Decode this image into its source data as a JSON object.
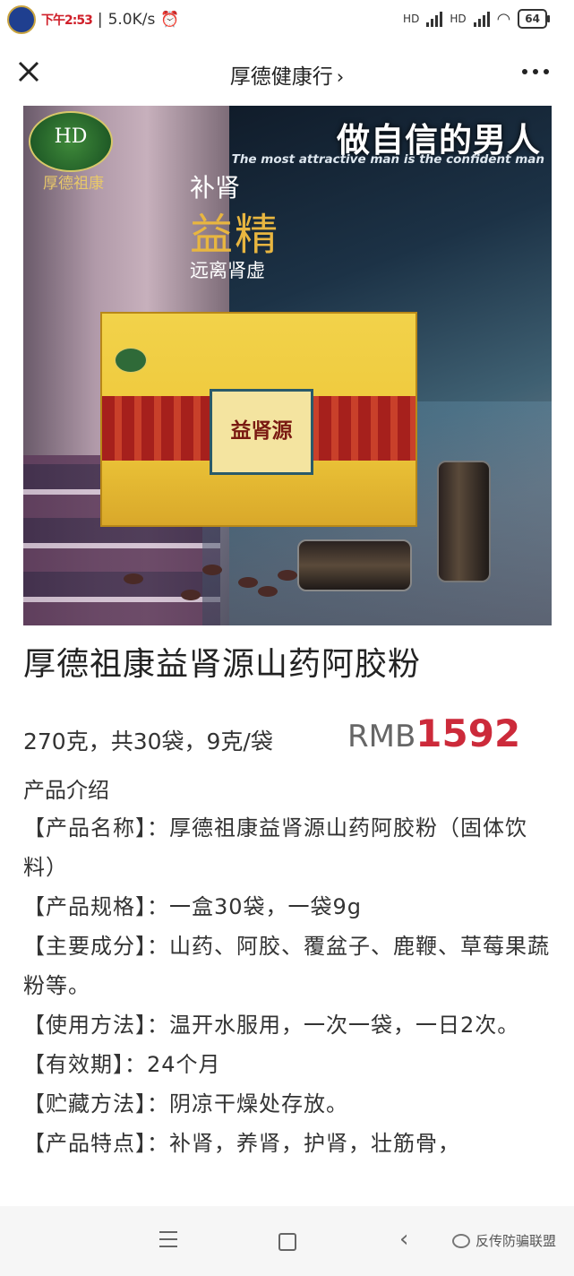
{
  "status_bar": {
    "time_label": "下午2:53",
    "speed": "5.0K/s",
    "network_left": "HD",
    "network_right": "HD",
    "battery": "64"
  },
  "nav": {
    "title": "厚德健康行",
    "chevron": "›"
  },
  "banner": {
    "logo_hd": "HD",
    "logo_text": "厚德祖康",
    "slogan_cn": "做自信的男人",
    "slogan_en": "The most attractive man is the confident man",
    "tag_top": "补肾",
    "tag_big": "益精",
    "tag_bottom": "远离肾虚",
    "box_title": "益肾源"
  },
  "product": {
    "title": "厚德祖康益肾源山药阿胶粉",
    "spec": "270克，共30袋，9克/袋",
    "price_currency": "RMB",
    "price_value": "1592",
    "intro_heading": "产品介绍",
    "details": [
      "【产品名称】：厚德祖康益肾源山药阿胶粉（固体饮料）",
      "【产品规格】：一盒30袋，一袋9g",
      "【主要成分】：山药、阿胶、覆盆子、鹿鞭、草莓果蔬粉等。",
      "【使用方法】：温开水服用，一次一袋，一日2次。",
      "【有效期】：24个月",
      "【贮藏方法】：阴凉干燥处存放。",
      "【产品特点】：补肾，养肾，护肾，壮筋骨，"
    ]
  },
  "bottom_nav": {
    "watermark": "反传防骗联盟"
  },
  "colors": {
    "price_accent": "#cc2a3a",
    "banner_gold": "#e8b640"
  }
}
